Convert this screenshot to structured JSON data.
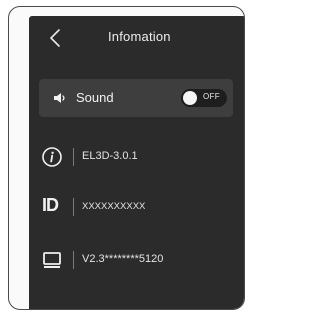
{
  "header": {
    "title": "Infomation",
    "back_icon": "chevron-left-icon"
  },
  "sound": {
    "label": "Sound",
    "icon": "speaker-icon",
    "toggle_state": "OFF"
  },
  "info_rows": [
    {
      "icon": "info-icon",
      "value": "EL3D-3.0.1"
    },
    {
      "icon": "id-icon",
      "icon_text": "ID",
      "value": "XXXXXXXXXX"
    },
    {
      "icon": "display-icon",
      "value": "V2.3********5120"
    }
  ],
  "colors": {
    "screen_bg": "#2b2b2b",
    "card_bg": "#3e3e3e",
    "text": "#ececec"
  }
}
